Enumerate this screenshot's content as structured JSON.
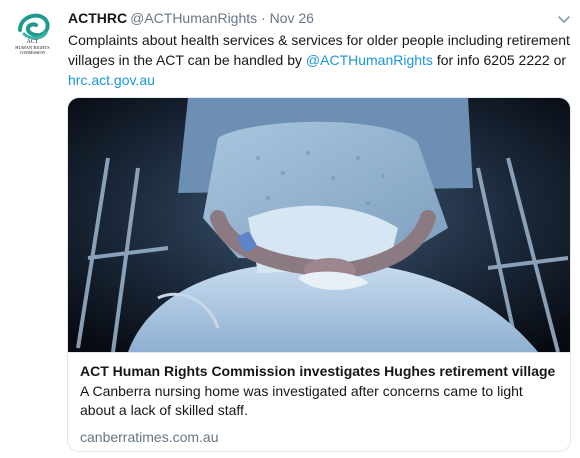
{
  "tweet": {
    "author": {
      "display_name": "ACTHRC",
      "handle": "@ACTHumanRights",
      "avatar_text": "ACT HUMAN RIGHTS COMMISSION"
    },
    "separator": "·",
    "date": "Nov 26",
    "menu_icon": "chevron-down-icon",
    "text": {
      "line1": "Complaints about health services & services for older people including retirement",
      "line2_pre": "villages in the ACT can be handled by ",
      "mention": "@ACTHumanRights",
      "line2_post": " for info 6205 2222 or",
      "link": "hrc.act.gov.au"
    },
    "card": {
      "image_alt": "Elderly patient lying in a hospital bed",
      "title": "ACT Human Rights Commission investigates Hughes retirement village",
      "description": "A Canberra nursing home was investigated after concerns came to light about a lack of skilled staff.",
      "domain": "canberratimes.com.au"
    }
  },
  "colors": {
    "link": "#1b95e0",
    "secondary_text": "#657786",
    "primary_text": "#14171a",
    "border": "#e1e8ed",
    "avatar_teal": "#1f9a8f"
  }
}
